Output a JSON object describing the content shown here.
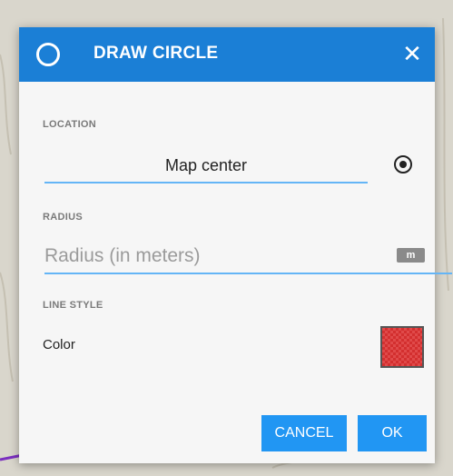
{
  "dialog": {
    "title": "DRAW CIRCLE",
    "header_icon": "circle-outline-icon",
    "close_icon": "close-icon",
    "close_symbol": "✕"
  },
  "location": {
    "label": "LOCATION",
    "value": "Map center",
    "action_icon": "target-location-icon"
  },
  "radius": {
    "label": "RADIUS",
    "value": "",
    "placeholder": "Radius (in meters)",
    "unit": "m"
  },
  "line_style": {
    "label": "LINE STYLE",
    "color_label": "Color",
    "color_value": "#d32f2f"
  },
  "buttons": {
    "cancel": "CANCEL",
    "ok": "OK"
  },
  "colors": {
    "header": "#1b7fd6",
    "accent": "#2196f3",
    "underline": "#64b5f6",
    "map_route": "#7b2fbf"
  }
}
